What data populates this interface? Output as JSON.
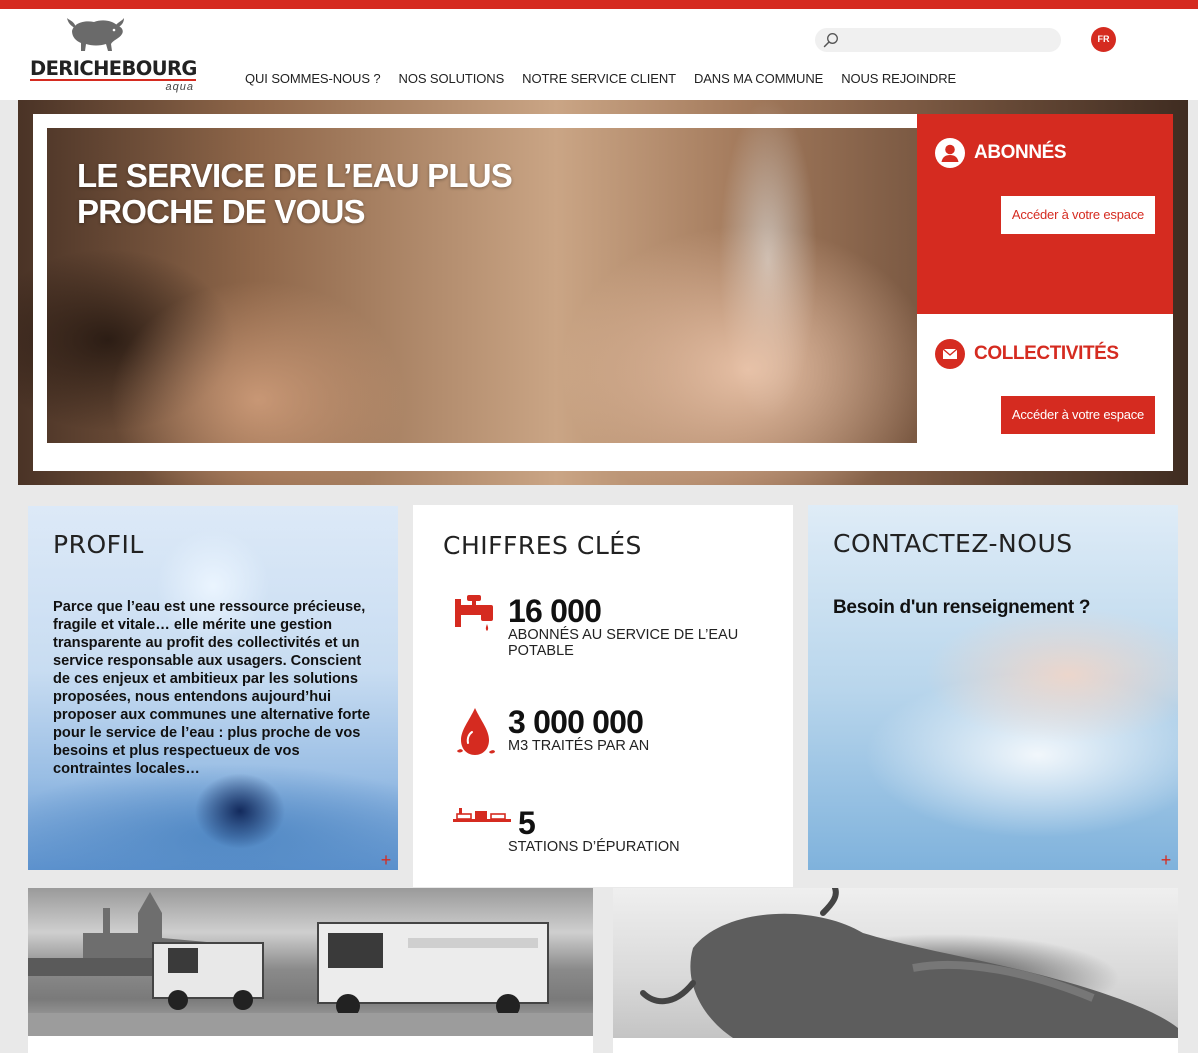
{
  "brand": {
    "name": "DERICHEBOURG",
    "sub": "aqua"
  },
  "search": {
    "placeholder": ""
  },
  "lang": "FR",
  "nav": [
    "QUI SOMMES-NOUS ?",
    "NOS SOLUTIONS",
    "NOTRE SERVICE CLIENT",
    "DANS MA COMMUNE",
    "NOUS REJOINDRE"
  ],
  "hero": {
    "line1": "LE SERVICE DE L’EAU PLUS",
    "line2": "PROCHE DE VOUS"
  },
  "abonnes": {
    "title": "ABONNÉS",
    "button": "Accéder à votre espace"
  },
  "collectivites": {
    "title": "COLLECTIVITÉS",
    "button": "Accéder à votre espace"
  },
  "profil": {
    "title": "PROFIL",
    "text": "Parce que l’eau est une ressource précieuse, fragile et vitale… elle mérite une gestion transparente au profit des collectivités et un service responsable aux usagers. Conscient de ces enjeux et ambitieux par les solutions proposées, nous entendons aujourd’hui proposer aux communes une alternative forte pour le service de l’eau : plus proche de vos besoins et plus respectueux de vos contraintes locales…",
    "more": "+"
  },
  "chiffres": {
    "title": "CHIFFRES CLÉS",
    "items": [
      {
        "icon": "faucet-icon",
        "value": "16 000",
        "label": "ABONNÉS AU SERVICE DE L’EAU POTABLE"
      },
      {
        "icon": "water-drop-icon",
        "value": "3 000 000",
        "label": "M3 TRAITÉS PAR AN"
      },
      {
        "icon": "treatment-plant-icon",
        "value": "5",
        "label": "STATIONS D’ÉPURATION"
      }
    ]
  },
  "contact": {
    "title": "CONTACTEZ-NOUS",
    "text": "Besoin d'un renseignement ?",
    "more": "+"
  },
  "colors": {
    "accent": "#d52b20",
    "text": "#111111",
    "background": "#e9e9e9"
  }
}
